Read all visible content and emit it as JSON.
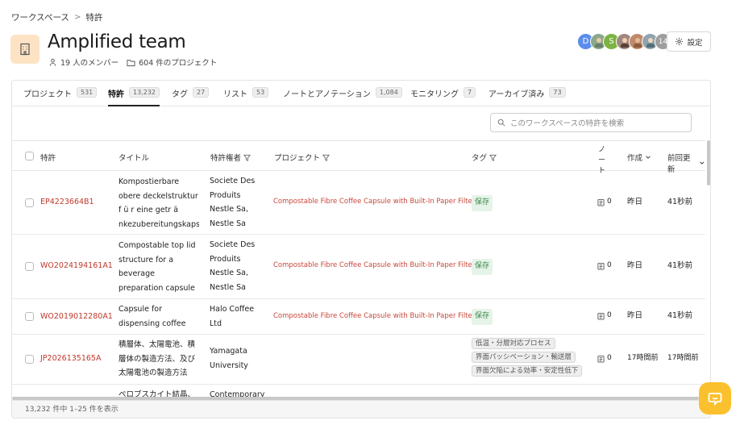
{
  "breadcrumb": {
    "root": "ワークスペース",
    "separator": ">",
    "current": "特許"
  },
  "team": {
    "title": "Amplified team",
    "members": "19 人のメンバー",
    "projects": "604 件のプロジェクト"
  },
  "avatars": [
    {
      "initial": "D",
      "color": "#5b8def"
    },
    {
      "initial": "",
      "color": "#8aa88c"
    },
    {
      "initial": "S",
      "color": "#7cb342"
    },
    {
      "initial": "",
      "color": "#a1887f"
    },
    {
      "initial": "",
      "color": "#c08a6a"
    },
    {
      "initial": "",
      "color": "#90a4ae"
    },
    {
      "initial": "14",
      "color": "#9e9e9e"
    }
  ],
  "settings_label": "設定",
  "tabs": [
    {
      "label": "プロジェクト",
      "count": "531"
    },
    {
      "label": "特許",
      "count": "13,232"
    },
    {
      "label": "タグ",
      "count": "27"
    },
    {
      "label": "リスト",
      "count": "53"
    },
    {
      "label": "ノートとアノテーション",
      "count": "1,084"
    },
    {
      "label": "モニタリング",
      "count": "7"
    },
    {
      "label": "アーカイブ済み",
      "count": "73"
    }
  ],
  "search": {
    "placeholder": "このワークスペースの特許を検索"
  },
  "columns": {
    "patent": "特許",
    "title": "タイトル",
    "assignee": "特許権者",
    "project": "プロジェクト",
    "tags": "タグ",
    "notes": "ノート",
    "created": "作成",
    "updated": "前回更新"
  },
  "rows": [
    {
      "id": "EP4223664B1",
      "title": "Kompostierbare obere deckelstruktur f ü r eine getr ä nkezubereitungskaps…",
      "assignee": "Societe Des Produits Nestle Sa, Nestle Sa",
      "project": "Compostable Fibre Coffee Capsule with Built-In Paper Filter",
      "tags": [
        "保存"
      ],
      "notes": "0",
      "created": "昨日",
      "updated": "41秒前"
    },
    {
      "id": "WO2024194161A1",
      "title": "Compostable top lid structure for a beverage preparation capsule",
      "assignee": "Societe Des Produits Nestle Sa, Nestle Sa",
      "project": "Compostable Fibre Coffee Capsule with Built-In Paper Filter",
      "tags": [
        "保存"
      ],
      "notes": "0",
      "created": "昨日",
      "updated": "41秒前"
    },
    {
      "id": "WO2019012280A1",
      "title": "Capsule for dispensing coffee",
      "assignee": "Halo Coffee Ltd",
      "project": "Compostable Fibre Coffee Capsule with Built-In Paper Filter",
      "tags": [
        "保存"
      ],
      "notes": "0",
      "created": "昨日",
      "updated": "41秒前"
    },
    {
      "id": "JP2026135165A",
      "title": "積層体、太陽電池、積層体の製造方法、及び太陽電池の製造方法",
      "assignee": "Yamagata University",
      "project": "",
      "tags": [
        "低温・分層対応プロセス",
        "界面パッシベーション・輸送層",
        "界面欠陥による効率・安定性低下"
      ],
      "notes": "0",
      "created": "17時間前",
      "updated": "17時間前"
    },
    {
      "id": "",
      "title": "ペロブスカイト結晶、",
      "assignee": "Contemporary",
      "project": "",
      "tags": [],
      "notes": "",
      "created": "",
      "updated": ""
    }
  ],
  "footer": {
    "text": "13,232 件中 1–25 件を表示"
  },
  "colors": {
    "accent": "#c0392b",
    "chat": "#fbc02d",
    "tag_green": "#3a8a4a"
  }
}
